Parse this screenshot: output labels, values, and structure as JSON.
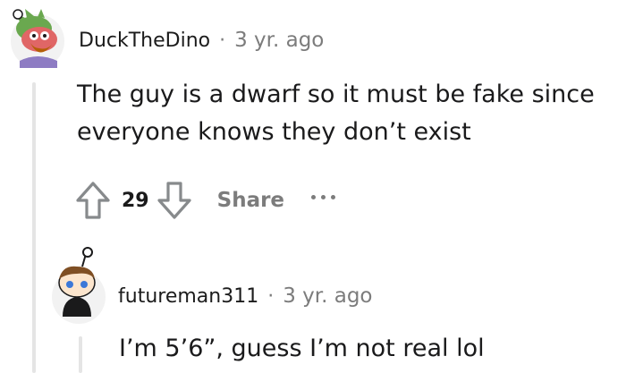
{
  "comments": [
    {
      "username": "DuckTheDino",
      "separator": "·",
      "time": "3 yr. ago",
      "body_lines": [
        "The guy is a dwarf so it must be fake since",
        "everyone knows they don’t exist"
      ],
      "score": "29",
      "share_label": "Share",
      "avatar_icon": "dino-avatar-icon"
    },
    {
      "username": "futureman311",
      "separator": "·",
      "time": "3 yr. ago",
      "body_lines": [
        "I’m 5’6”, guess I’m not real lol"
      ],
      "avatar_icon": "snoo-avatar-icon"
    }
  ],
  "colors": {
    "text": "#1a1a1b",
    "muted": "#7c7c7c",
    "thread_line": "#e5e5e5"
  }
}
